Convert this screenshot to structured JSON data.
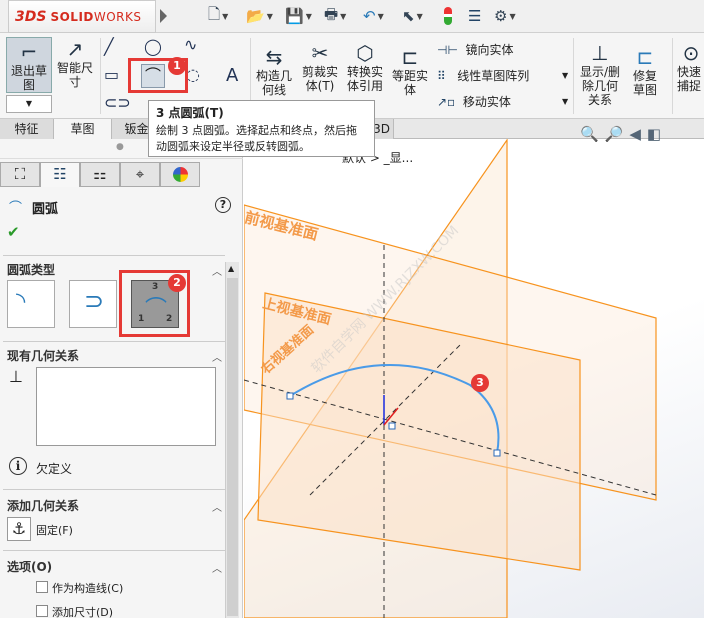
{
  "titlebar": {
    "brand_prefix": "3DS",
    "brand_bold": "SOLID",
    "brand_light": "WORKS"
  },
  "ribbon": {
    "exit_sketch": "退出草图",
    "smart_dim": "智能尺寸",
    "construction": "构造几何线",
    "trim": "剪裁实体(T)",
    "convert": "转换实体引用",
    "offset": "等距实体",
    "mirror": "镜向实体",
    "linear_pattern": "线性草图阵列",
    "move": "移动实体",
    "show_relations": "显示/删除几何关系",
    "repair": "修复草图",
    "quick_snap": "快速捕捉"
  },
  "tabs": [
    {
      "label": "特征"
    },
    {
      "label": "草图"
    },
    {
      "label": "钣金"
    },
    {
      "label": "3D"
    }
  ],
  "tooltip": {
    "title": "3 点圆弧(T)",
    "body": "绘制 3 点圆弧。选择起点和终点，然后拖动圆弧来设定半径或反转圆弧。"
  },
  "breadcrumb": "默认 > _显...",
  "panel": {
    "title": "圆弧",
    "help": "?",
    "arc_type": "圆弧类型",
    "existing_relations": "现有几何关系",
    "status": "欠定义",
    "add_relations": "添加几何关系",
    "fix": "固定(F)",
    "options": "选项(O)",
    "opt_construction": "作为构造线(C)",
    "opt_dimension": "添加尺寸(D)",
    "arc_labels": {
      "a1": "1",
      "a2": "2",
      "a3": "3"
    }
  },
  "viewport": {
    "plane_front": "前视基准面",
    "plane_top": "上视基准面",
    "plane_right": "右视基准面",
    "watermark": "软件自学网 WWW.RJZXW.COM"
  },
  "badges": {
    "b1": "1",
    "b2": "2",
    "b3": "3"
  },
  "colors": {
    "accent_red": "#e53935",
    "plane": "#f7931e",
    "arc": "#4a9be8"
  }
}
